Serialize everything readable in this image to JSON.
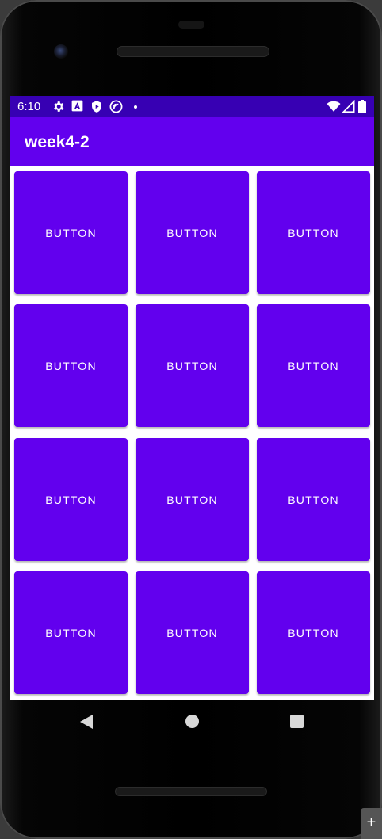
{
  "status_bar": {
    "time": "6:10",
    "left_icons": [
      "gear-icon",
      "font-a-icon",
      "shield-play-icon",
      "circle-signal-icon",
      "dot-icon"
    ],
    "right_icons": [
      "wifi-icon",
      "cell-signal-icon",
      "battery-icon"
    ]
  },
  "app_bar": {
    "title": "week4-2"
  },
  "grid": {
    "buttons": [
      "BUTTON",
      "BUTTON",
      "BUTTON",
      "BUTTON",
      "BUTTON",
      "BUTTON",
      "BUTTON",
      "BUTTON",
      "BUTTON",
      "BUTTON",
      "BUTTON",
      "BUTTON"
    ]
  },
  "nav_bar": {
    "icons": [
      "back-icon",
      "home-icon",
      "recents-icon"
    ]
  },
  "emulator": {
    "expand_label": "+"
  },
  "colors": {
    "status_bar": "#3700b3",
    "primary": "#6200ee",
    "background": "#ffffff"
  }
}
